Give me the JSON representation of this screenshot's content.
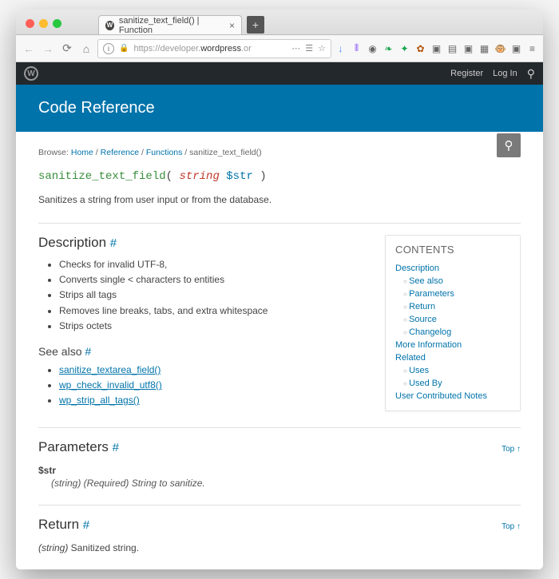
{
  "browser": {
    "tab_title": "sanitize_text_field() | Function",
    "url_prefix": "https://developer.",
    "url_host": "wordpress",
    "url_suffix": ".or",
    "register": "Register",
    "login": "Log In"
  },
  "hero_title": "Code Reference",
  "breadcrumbs": {
    "prefix": "Browse:",
    "home": "Home",
    "reference": "Reference",
    "functions": "Functions",
    "current": "sanitize_text_field()"
  },
  "signature": {
    "fn": "sanitize_text_field",
    "type": "string",
    "var": "$str"
  },
  "summary": "Sanitizes a string from user input or from the database.",
  "toc": {
    "title": "CONTENTS",
    "items": {
      "description": "Description",
      "see_also": "See also",
      "parameters": "Parameters",
      "return": "Return",
      "source": "Source",
      "changelog": "Changelog",
      "more_info": "More Information",
      "related": "Related",
      "uses": "Uses",
      "used_by": "Used By",
      "notes": "User Contributed Notes"
    }
  },
  "description": {
    "heading": "Description",
    "bullets": [
      "Checks for invalid UTF-8,",
      "Converts single < characters to entities",
      "Strips all tags",
      "Removes line breaks, tabs, and extra whitespace",
      "Strips octets"
    ],
    "see_also_heading": "See also",
    "see_also_links": [
      "sanitize_textarea_field()",
      "wp_check_invalid_utf8()",
      "wp_strip_all_tags()"
    ]
  },
  "parameters": {
    "heading": "Parameters",
    "name": "$str",
    "meta": "(string) (Required)",
    "desc": " String to sanitize."
  },
  "return": {
    "heading": "Return",
    "meta": "(string)",
    "desc": " Sanitized string."
  },
  "top_link": "Top ↑",
  "anchor_mark": "#"
}
